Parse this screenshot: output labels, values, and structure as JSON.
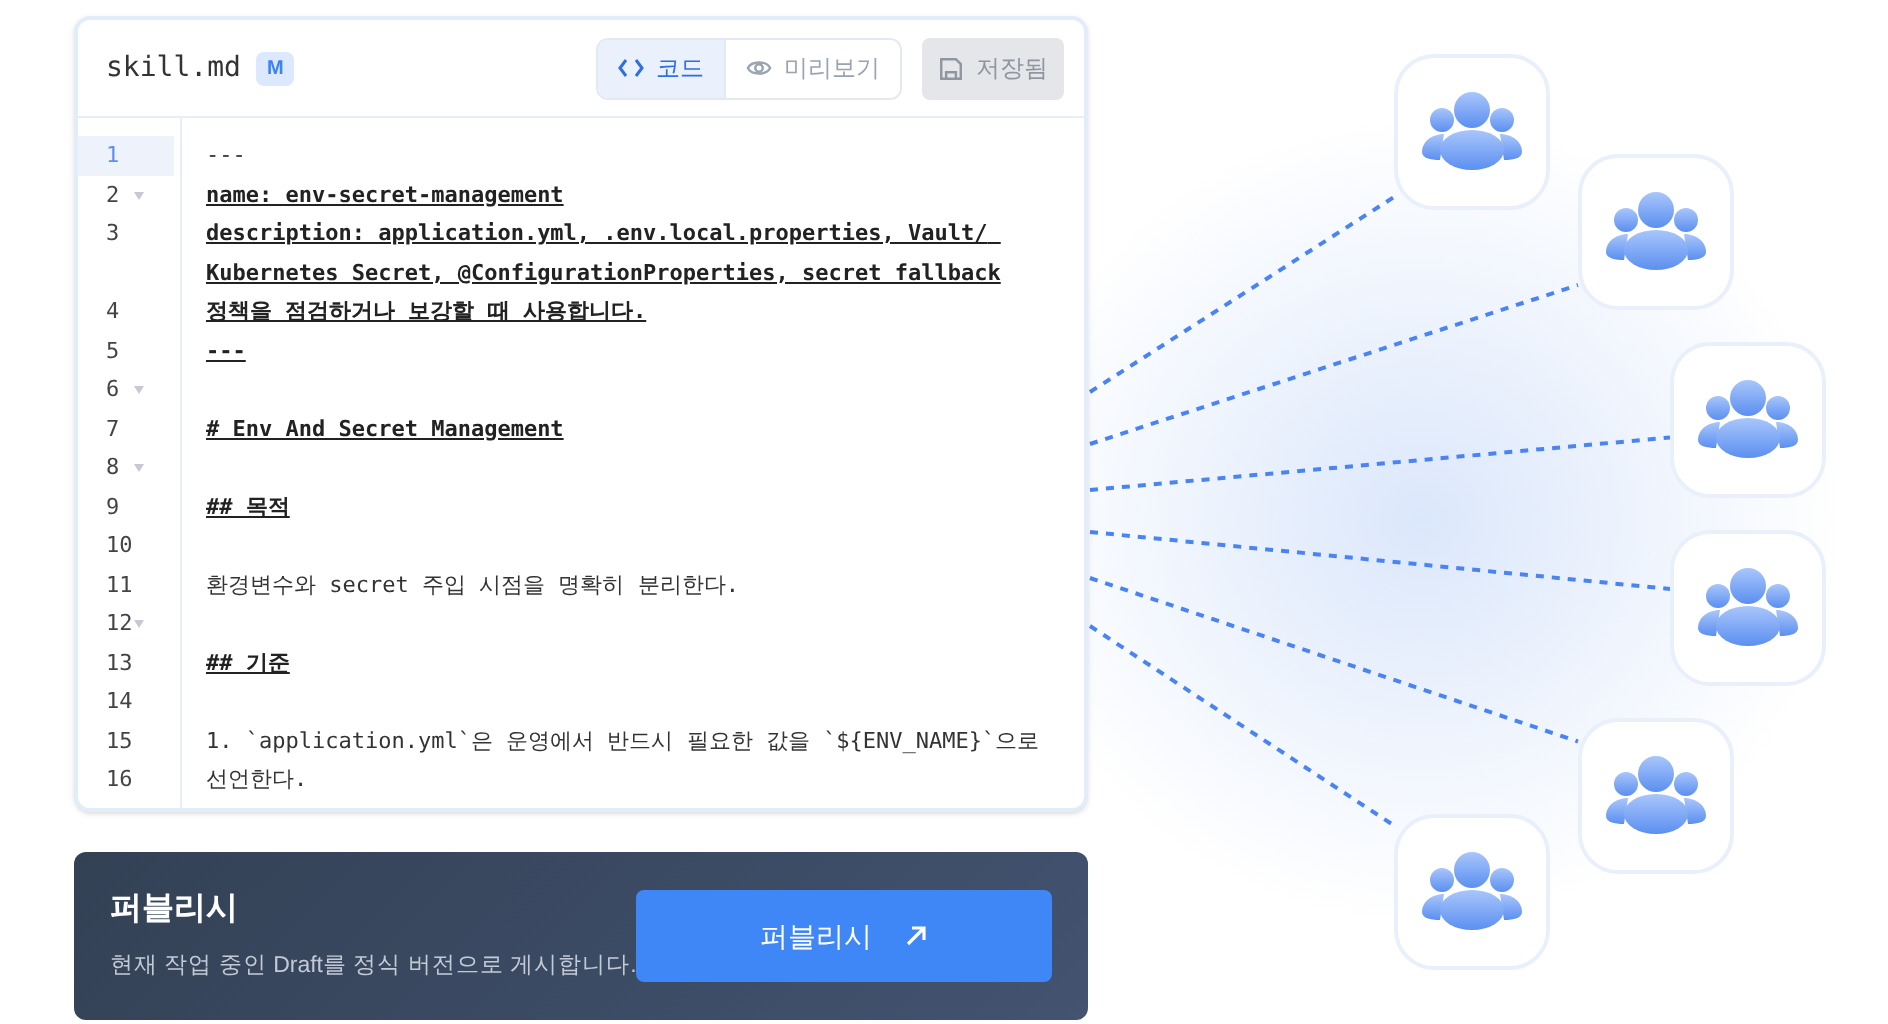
{
  "editor": {
    "filename": "skill.md",
    "badge": "M",
    "view_tabs": [
      {
        "label": "코드",
        "kind": "code",
        "selected": true
      },
      {
        "label": "미리보기",
        "kind": "preview",
        "selected": false
      }
    ],
    "save_button": {
      "label": "저장됨",
      "disabled": true
    },
    "lines": [
      {
        "number": "1",
        "text": "---",
        "kind": "plain",
        "active": true,
        "foldable": false
      },
      {
        "number": "2",
        "text": "name: env-secret-management",
        "kind": "meta",
        "active": false,
        "foldable": true
      },
      {
        "number": "3",
        "text": "description: application.yml, .env.local.properties, Vault/ Kubernetes Secret, @ConfigurationProperties, secret fallback",
        "kind": "meta",
        "active": false,
        "foldable": false
      },
      {
        "number": "4",
        "text": "정책을 점검하거나 보강할 때 사용합니다.",
        "kind": "meta",
        "active": false,
        "foldable": false
      },
      {
        "number": "5",
        "text": "---",
        "kind": "meta",
        "active": false,
        "foldable": false
      },
      {
        "number": "6",
        "kind": "blank",
        "active": false,
        "foldable": true
      },
      {
        "number": "7",
        "text": "# Env And Secret Management",
        "kind": "heading",
        "active": false,
        "foldable": false
      },
      {
        "number": "8",
        "kind": "blank",
        "active": false,
        "foldable": true
      },
      {
        "number": "9",
        "text": "## 목적",
        "kind": "heading",
        "active": false,
        "foldable": false
      },
      {
        "number": "10",
        "kind": "blank",
        "active": false,
        "foldable": false
      },
      {
        "number": "11",
        "text": "환경변수와 secret 주입 시점을 명확히 분리한다.",
        "kind": "plain",
        "active": false,
        "foldable": false
      },
      {
        "number": "12",
        "kind": "blank",
        "active": false,
        "foldable": true
      },
      {
        "number": "13",
        "text": "## 기준",
        "kind": "heading",
        "active": false,
        "foldable": false
      },
      {
        "number": "14",
        "kind": "blank",
        "active": false,
        "foldable": false
      },
      {
        "number": "15",
        "text": "1. `application.yml`은 운영에서 반드시 필요한 값을 `${ENV_NAME}`으로",
        "kind": "plain",
        "active": false,
        "foldable": false
      },
      {
        "number": "16",
        "text": "선언한다.",
        "kind": "plain",
        "active": false,
        "foldable": false
      }
    ]
  },
  "publish": {
    "title": "퍼블리시",
    "description": "현재 작업 중인 Draft를 정식 버전으로 게시합니다.",
    "button": "퍼블리시"
  }
}
